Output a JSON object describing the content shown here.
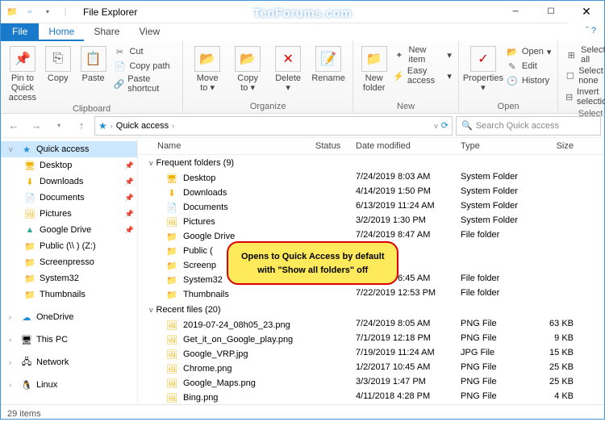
{
  "window": {
    "title": "File Explorer"
  },
  "watermark": "TenForums.com",
  "menubar": {
    "file": "File",
    "home": "Home",
    "share": "Share",
    "view": "View"
  },
  "ribbon": {
    "clipboard": {
      "label": "Clipboard",
      "pin": "Pin to Quick\naccess",
      "copy": "Copy",
      "paste": "Paste",
      "cut": "Cut",
      "copypath": "Copy path",
      "shortcut": "Paste shortcut"
    },
    "organize": {
      "label": "Organize",
      "moveto": "Move\nto",
      "copyto": "Copy\nto",
      "delete": "Delete",
      "rename": "Rename"
    },
    "new": {
      "label": "New",
      "newfolder": "New\nfolder",
      "newitem": "New item",
      "easyaccess": "Easy access"
    },
    "open": {
      "label": "Open",
      "properties": "Properties",
      "open": "Open",
      "edit": "Edit",
      "history": "History"
    },
    "select": {
      "label": "Select",
      "all": "Select all",
      "none": "Select none",
      "invert": "Invert selection"
    }
  },
  "address": {
    "location": "Quick access",
    "search_placeholder": "Search Quick access"
  },
  "nav": {
    "quickaccess": "Quick access",
    "items": [
      {
        "icon": "🖥",
        "label": "Desktop"
      },
      {
        "icon": "⬇",
        "label": "Downloads"
      },
      {
        "icon": "📄",
        "label": "Documents"
      },
      {
        "icon": "🖼",
        "label": "Pictures"
      },
      {
        "icon": "▲",
        "label": "Google Drive",
        "color": "green"
      },
      {
        "icon": "📁",
        "label": "Public (\\\\                  ) (Z:)"
      },
      {
        "icon": "📁",
        "label": "Screenpresso"
      },
      {
        "icon": "📁",
        "label": "System32"
      },
      {
        "icon": "📁",
        "label": "Thumbnails"
      }
    ],
    "onedrive": "OneDrive",
    "thispc": "This PC",
    "network": "Network",
    "linux": "Linux"
  },
  "columns": {
    "name": "Name",
    "status": "Status",
    "date": "Date modified",
    "type": "Type",
    "size": "Size"
  },
  "groups": {
    "freq": {
      "title": "Frequent folders (9)",
      "rows": [
        {
          "icon": "🖥",
          "name": "Desktop",
          "date": "7/24/2019 8:03 AM",
          "type": "System Folder",
          "size": ""
        },
        {
          "icon": "⬇",
          "name": "Downloads",
          "date": "4/14/2019 1:50 PM",
          "type": "System Folder",
          "size": ""
        },
        {
          "icon": "📄",
          "name": "Documents",
          "date": "6/13/2019 11:24 AM",
          "type": "System Folder",
          "size": ""
        },
        {
          "icon": "🖼",
          "name": "Pictures",
          "date": "3/2/2019 1:30 PM",
          "type": "System Folder",
          "size": ""
        },
        {
          "icon": "📁",
          "name": "Google Drive",
          "date": "7/24/2019 8:47 AM",
          "type": "File folder",
          "size": ""
        },
        {
          "icon": "📁",
          "name": "Public (",
          "date": "",
          "type": "",
          "size": ""
        },
        {
          "icon": "📁",
          "name": "Screenp",
          "date": "",
          "type": "",
          "size": ""
        },
        {
          "icon": "📁",
          "name": "System32",
          "date": "7/21/2019 6:45 AM",
          "type": "File folder",
          "size": ""
        },
        {
          "icon": "📁",
          "name": "Thumbnails",
          "date": "7/22/2019 12:53 PM",
          "type": "File folder",
          "size": ""
        }
      ]
    },
    "recent": {
      "title": "Recent files (20)",
      "rows": [
        {
          "icon": "🖼",
          "name": "2019-07-24_08h05_23.png",
          "date": "7/24/2019 8:05 AM",
          "type": "PNG File",
          "size": "63 KB"
        },
        {
          "icon": "🖼",
          "name": "Get_it_on_Google_play.png",
          "date": "7/1/2019 12:18 PM",
          "type": "PNG File",
          "size": "9 KB"
        },
        {
          "icon": "🖼",
          "name": "Google_VRP.jpg",
          "date": "7/19/2019 11:24 AM",
          "type": "JPG File",
          "size": "15 KB"
        },
        {
          "icon": "🖼",
          "name": "Chrome.png",
          "date": "1/2/2017 10:45 AM",
          "type": "PNG File",
          "size": "25 KB"
        },
        {
          "icon": "🖼",
          "name": "Google_Maps.png",
          "date": "3/3/2019 1:47 PM",
          "type": "PNG File",
          "size": "25 KB"
        },
        {
          "icon": "🖼",
          "name": "Bing.png",
          "date": "4/11/2018 4:28 PM",
          "type": "PNG File",
          "size": "4 KB"
        }
      ]
    }
  },
  "status": {
    "items": "29 items"
  },
  "callout": {
    "line1": "Opens to Quick Access by default",
    "line2": "with \"Show all folders\" off"
  }
}
